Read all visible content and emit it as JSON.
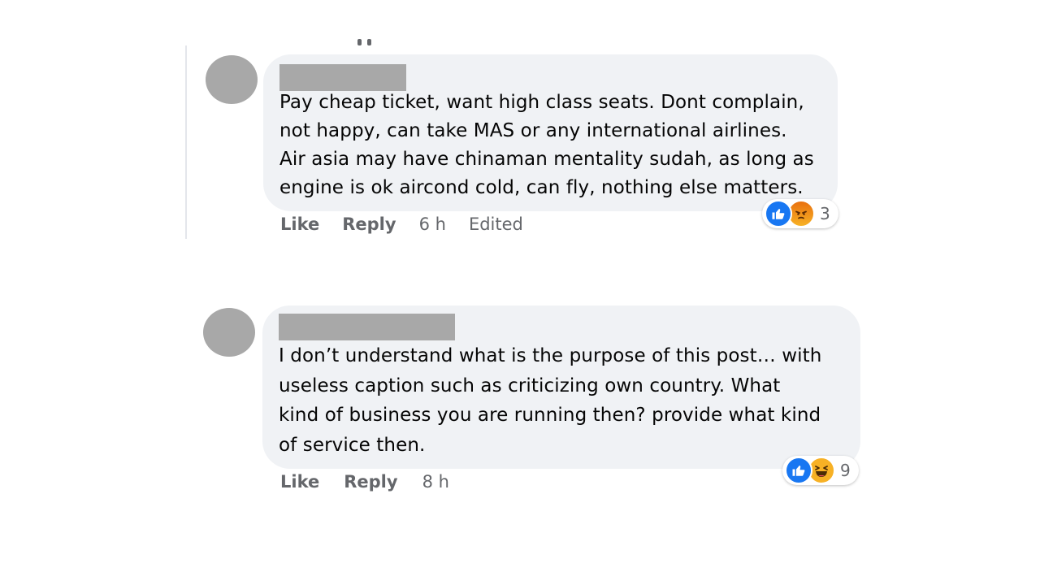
{
  "comments": [
    {
      "text_lines": [
        "Pay cheap ticket, want high class seats. Dont complain,",
        "not happy, can take MAS or any international airlines.",
        "Air asia may have chinaman mentality sudah, as long as",
        "engine is ok aircond cold, can fly, nothing else matters."
      ],
      "reactions": {
        "icons": [
          "like-icon",
          "angry-icon"
        ],
        "count": "3"
      },
      "actions": {
        "like": "Like",
        "reply": "Reply",
        "time": "6 h",
        "edited": "Edited"
      }
    },
    {
      "text_lines": [
        "I don’t understand what is the purpose of this post… with",
        "useless caption such as criticizing own country. What",
        "kind of business you are running then? provide what kind",
        "of service then."
      ],
      "reactions": {
        "icons": [
          "like-icon",
          "haha-icon"
        ],
        "count": "9"
      },
      "actions": {
        "like": "Like",
        "reply": "Reply",
        "time": "8 h"
      }
    }
  ],
  "colors": {
    "bubble": "#f0f2f5",
    "redaction": "#a8a8a8",
    "secondary_text": "#65676b",
    "like_blue": "#1877f2",
    "angry_orange": "#e9710f",
    "haha_yellow": "#f7b125"
  }
}
